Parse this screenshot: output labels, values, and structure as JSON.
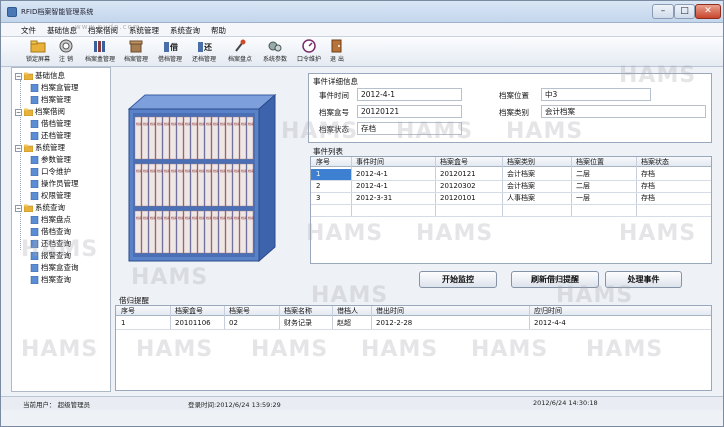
{
  "window": {
    "title": "RFID档案智能管理系统",
    "min": "–",
    "max": "□",
    "close": "✕"
  },
  "menu": [
    "文件",
    "基础信息",
    "档案借阅",
    "系统管理",
    "系统查询",
    "帮助"
  ],
  "toolbar": [
    {
      "label": "锁定屏幕",
      "icon": "lock-folder-icon"
    },
    {
      "label": "注 销",
      "icon": "logout-icon"
    },
    {
      "label": "档案盒管理",
      "icon": "box-management-icon"
    },
    {
      "label": "档案管理",
      "icon": "archive-icon"
    },
    {
      "label": "借档管理",
      "icon": "borrow-icon"
    },
    {
      "label": "还档管理",
      "icon": "return-icon"
    },
    {
      "label": "档案盘点",
      "icon": "inventory-icon"
    },
    {
      "label": "系统参数",
      "icon": "settings-icon"
    },
    {
      "label": "口令维护",
      "icon": "password-icon"
    },
    {
      "label": "退 出",
      "icon": "exit-icon"
    }
  ],
  "tree": [
    {
      "label": "基础信息",
      "level": 0,
      "toggle": "−"
    },
    {
      "label": "档案盒管理",
      "level": 1
    },
    {
      "label": "档案管理",
      "level": 1
    },
    {
      "label": "档案借阅",
      "level": 0,
      "toggle": "−"
    },
    {
      "label": "借档管理",
      "level": 1
    },
    {
      "label": "还档管理",
      "level": 1
    },
    {
      "label": "系统管理",
      "level": 0,
      "toggle": "−"
    },
    {
      "label": "参数管理",
      "level": 1
    },
    {
      "label": "口令维护",
      "level": 1
    },
    {
      "label": "操作员管理",
      "level": 1
    },
    {
      "label": "权限管理",
      "level": 1
    },
    {
      "label": "系统查询",
      "level": 0,
      "toggle": "−"
    },
    {
      "label": "档案盘点",
      "level": 1
    },
    {
      "label": "借档查询",
      "level": 1
    },
    {
      "label": "还档查询",
      "level": 1
    },
    {
      "label": "报警查询",
      "level": 1
    },
    {
      "label": "档案盒查询",
      "level": 1
    },
    {
      "label": "档案查询",
      "level": 1
    }
  ],
  "shelf": {
    "spine_text": "档案"
  },
  "detail": {
    "section": "事件详细信息",
    "event_time_label": "事件时间",
    "event_time": "2012-4-1",
    "location_label": "档案位置",
    "location": "中3",
    "box_label": "档案盒号",
    "box": "20120121",
    "category_label": "档案类别",
    "category": "会计档案",
    "status_label": "档案状态",
    "status": "存档"
  },
  "events": {
    "section": "事件列表",
    "columns": [
      "序号",
      "事件时间",
      "档案盒号",
      "档案类别",
      "档案位置",
      "档案状态"
    ],
    "rows": [
      [
        "1",
        "2012-4-1",
        "20120121",
        "会计档案",
        "二层",
        "存档"
      ],
      [
        "2",
        "2012-4-1",
        "20120302",
        "会计档案",
        "二层",
        "存档"
      ],
      [
        "3",
        "2012-3-31",
        "20120101",
        "人事档案",
        "一层",
        "存档"
      ]
    ]
  },
  "buttons": {
    "start": "开始监控",
    "refresh": "刷新借归提醒",
    "process": "处理事件"
  },
  "reminder": {
    "section": "借归提醒",
    "columns": [
      "序号",
      "档案盒号",
      "档案号",
      "档案名称",
      "借档人",
      "借出时间",
      "应归时间"
    ],
    "rows": [
      [
        "1",
        "20101106",
        "02",
        "财务记录",
        "赵超",
        "2012-2-28",
        "2012-4-4"
      ]
    ]
  },
  "statusbar": {
    "user": "当前用户： 超级管理员",
    "login": "登录时间:2012/6/24 13:59:29",
    "now": "2012/6/24 14:30:18"
  },
  "watermark": {
    "text": "HAMS",
    "site": "www.pudn.com"
  },
  "colors": {
    "selection": "#3d7fd0",
    "shelf": "#5a82c8",
    "close": "#c8452c"
  }
}
